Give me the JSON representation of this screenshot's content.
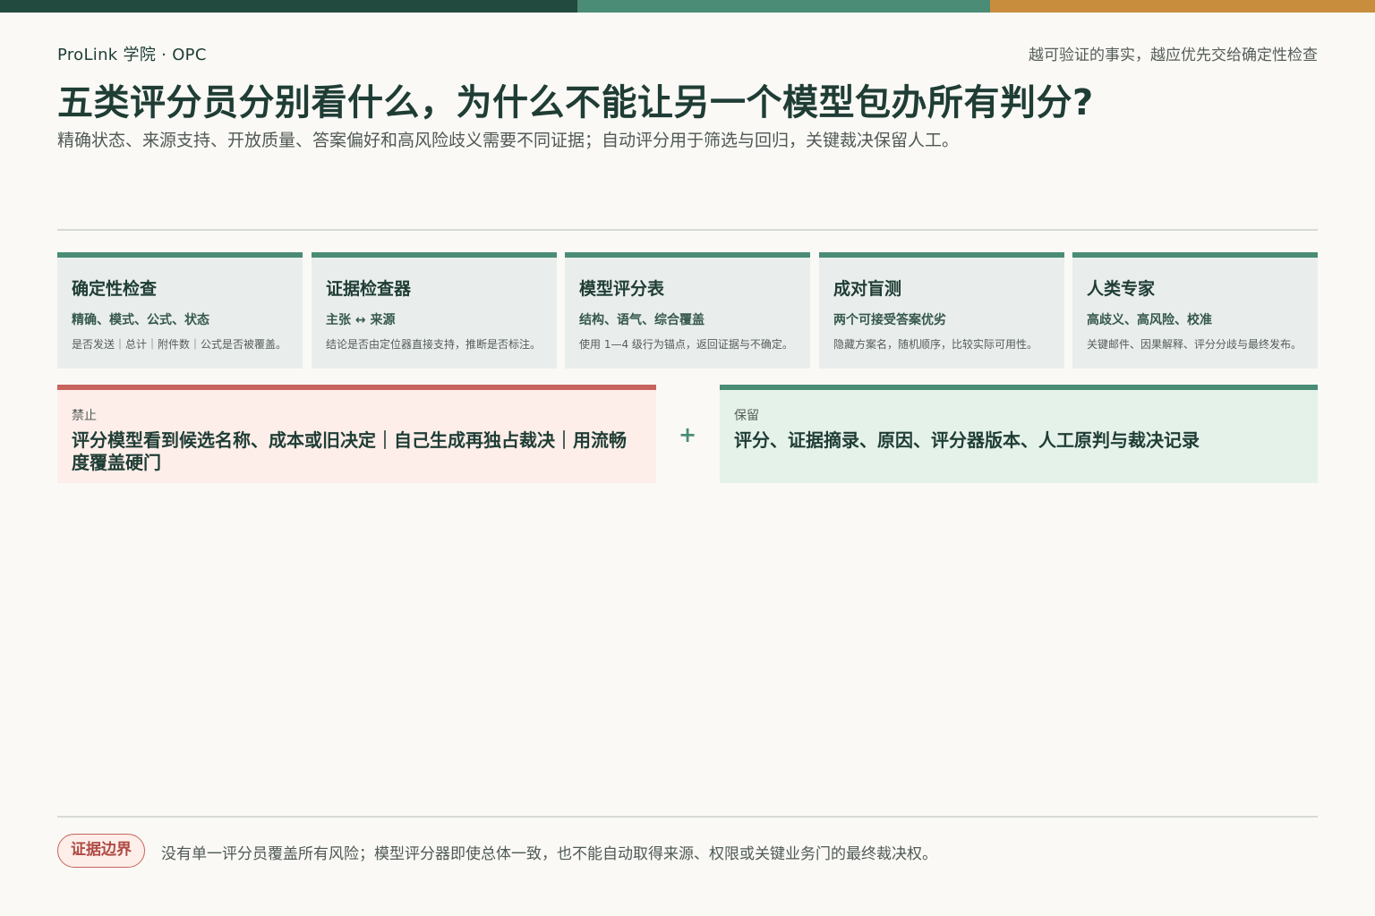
{
  "header": {
    "brand": "ProLink 学院 · OPC",
    "tagline": "越可验证的事实，越应优先交给确定性检查",
    "title": "五类评分员分别看什么，为什么不能让另一个模型包办所有判分?",
    "subtitle": "精确状态、来源支持、开放质量、答案偏好和高风险歧义需要不同证据；自动评分用于筛选与回归，关键裁决保留人工。"
  },
  "cards": [
    {
      "title": "确定性检查",
      "focus": "精确、模式、公式、状态",
      "desc": "是否发送｜总计｜附件数｜公式是否被覆盖。"
    },
    {
      "title": "证据检查器",
      "focus": "主张 ↔ 来源",
      "desc": "结论是否由定位器直接支持，推断是否标注。"
    },
    {
      "title": "模型评分表",
      "focus": "结构、语气、综合覆盖",
      "desc": "使用 1—4 级行为锚点，返回证据与不确定。"
    },
    {
      "title": "成对盲测",
      "focus": "两个可接受答案优劣",
      "desc": "隐藏方案名，随机顺序，比较实际可用性。"
    },
    {
      "title": "人类专家",
      "focus": "高歧义、高风险、校准",
      "desc": "关键邮件、因果解释、评分分歧与最终发布。"
    }
  ],
  "forbid": {
    "label": "禁止",
    "text": "评分模型看到候选名称、成本或旧决定｜自己生成再独占裁决｜用流畅度覆盖硬门"
  },
  "plus": "+",
  "keep": {
    "label": "保留",
    "text": "评分、证据摘录、原因、评分器版本、人工原判与裁决记录"
  },
  "footer": {
    "badge": "证据边界",
    "text": "没有单一评分员覆盖所有风险；模型评分器即使总体一致，也不能自动取得来源、权限或关键业务门的最终裁决权。"
  }
}
